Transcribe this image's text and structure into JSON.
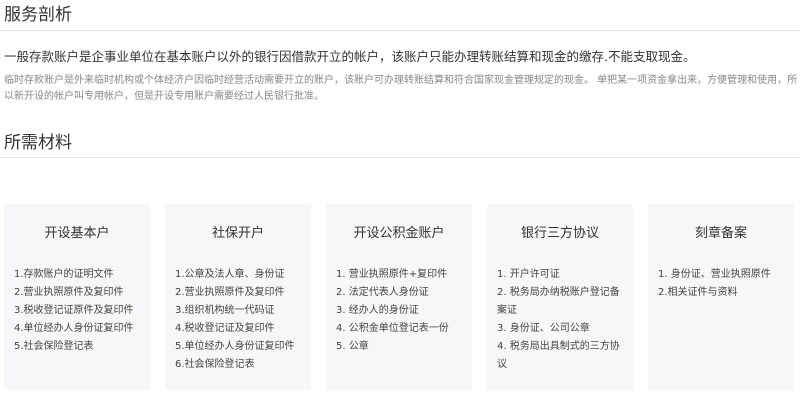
{
  "analysis": {
    "title": "服务剖析",
    "main_text": "一般存款账户是企事业单位在基本账户以外的银行因借款开立的帐户，该账户只能办理转账结算和现金的缴存.不能支取现金。",
    "sub_text": "临时存款账户是外来临时机构或个体经济户因临时经营活动需要开立的账户，该账户可办理转账结算和符合国家现金管理规定的现金。 单把某一项资金拿出来，方便管理和使用，所以新开设的帐户叫专用帐户，但是开设专用账户需要经过人民银行批准。"
  },
  "materials": {
    "title": "所需材料",
    "cards": [
      {
        "title": "开设基本户",
        "items": [
          "1.存款账户的证明文件",
          "2.营业执照原件及复印件",
          "3.税收登记证原件及复印件",
          "4.单位经办人身份证复印件",
          "5.社会保险登记表"
        ]
      },
      {
        "title": "社保开户",
        "items": [
          "1.公章及法人章、身份证",
          "2.营业执照原件及复印件",
          "3.组织机构统一代码证",
          "4.税收登记证及复印件",
          "5.单位经办人身份证复印件",
          "6.社会保险登记表"
        ]
      },
      {
        "title": "开设公积金账户",
        "items": [
          "1. 营业执照原件+复印件",
          "2. 法定代表人身份证",
          "3. 经办人的身份证",
          "4. 公积金单位登记表一份",
          "5. 公章"
        ]
      },
      {
        "title": "银行三方协议",
        "items": [
          "1. 开户许可证",
          "2. 税务局办纳税账户登记备案证",
          "3. 身份证、公司公章",
          "4. 税务局出具制式的三方协议"
        ]
      },
      {
        "title": "刻章备案",
        "items": [
          "1. 身份证、营业执照原件",
          "2.相关证件与资料"
        ]
      }
    ]
  }
}
